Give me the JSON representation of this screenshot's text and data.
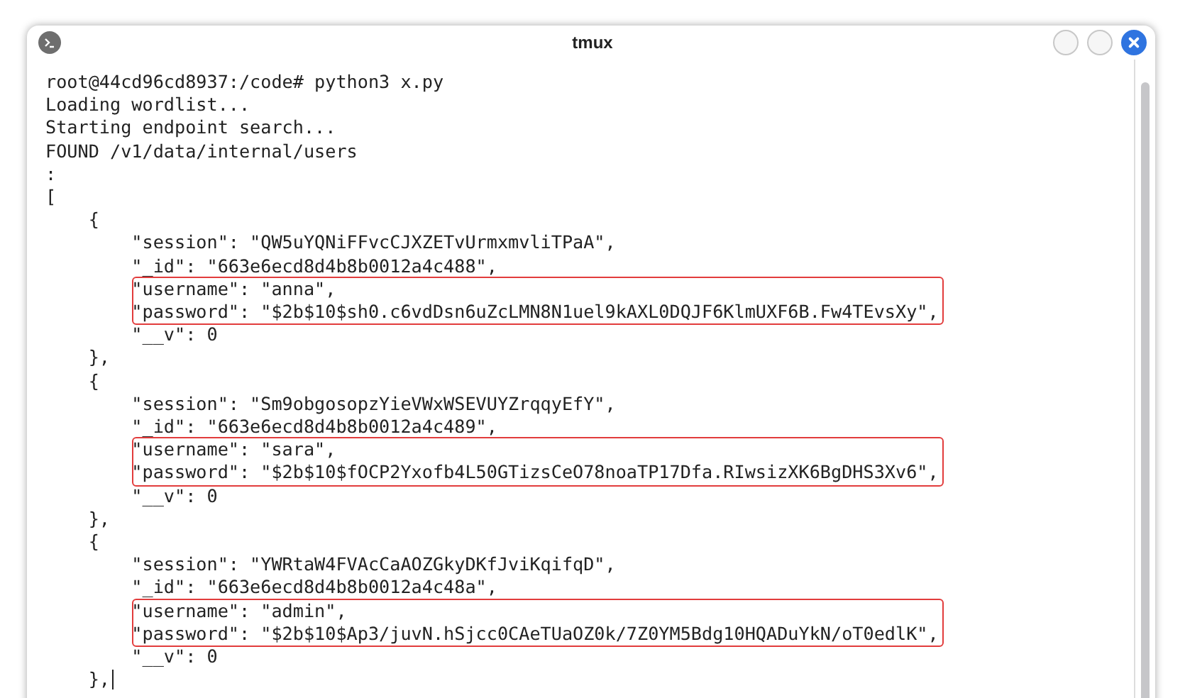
{
  "window": {
    "title": "tmux"
  },
  "terminal": [
    {
      "highlighted": false,
      "lines": [
        "root@44cd96cd8937:/code# python3 x.py",
        "Loading wordlist...",
        "Starting endpoint search...",
        "FOUND /v1/data/internal/users",
        ":",
        "[",
        "    {",
        "        \"session\": \"QW5uYQNiFFvcCJXZETvUrmxmvliTPaA\",",
        "        \"_id\": \"663e6ecd8d4b8b0012a4c488\","
      ]
    },
    {
      "highlighted": true,
      "lines": [
        "        \"username\": \"anna\",",
        "        \"password\": \"$2b$10$sh0.c6vdDsn6uZcLMN8N1uel9kAXL0DQJF6KlmUXF6B.Fw4TEvsXy\","
      ]
    },
    {
      "highlighted": false,
      "lines": [
        "        \"__v\": 0",
        "    },",
        "    {",
        "        \"session\": \"Sm9obgosopzYieVWxWSEVUYZrqqyEfY\",",
        "        \"_id\": \"663e6ecd8d4b8b0012a4c489\","
      ]
    },
    {
      "highlighted": true,
      "lines": [
        "        \"username\": \"sara\",",
        "        \"password\": \"$2b$10$fOCP2Yxofb4L50GTizsCeO78noaTP17Dfa.RIwsizXK6BgDHS3Xv6\","
      ]
    },
    {
      "highlighted": false,
      "lines": [
        "        \"__v\": 0",
        "    },",
        "    {",
        "        \"session\": \"YWRtaW4FVAcCaAOZGkyDKfJviKqifqD\",",
        "        \"_id\": \"663e6ecd8d4b8b0012a4c48a\","
      ]
    },
    {
      "highlighted": true,
      "lines": [
        "        \"username\": \"admin\",",
        "        \"password\": \"$2b$10$Ap3/juvN.hSjcc0CAeTUaOZ0k/7Z0YM5Bdg10HQADuYkN/oT0edlK\","
      ]
    },
    {
      "highlighted": false,
      "lines": [
        "        \"__v\": 0",
        "    },"
      ]
    }
  ]
}
